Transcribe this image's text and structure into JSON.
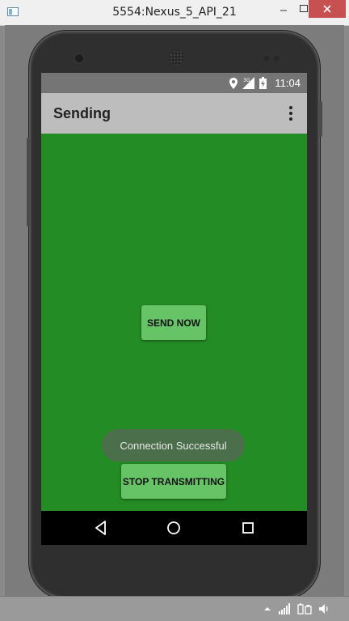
{
  "window": {
    "title": "5554:Nexus_5_API_21"
  },
  "device": {
    "status_bar": {
      "time": "11:04",
      "icons": [
        "location-icon",
        "signal-3g-icon",
        "battery-charging-icon"
      ]
    },
    "app_bar": {
      "title": "Sending",
      "overflow_icon": "more-vert-icon"
    },
    "content": {
      "send_button_label": "SEND NOW",
      "stop_button_label": "STOP TRANSMITTING",
      "toast_message": "Connection Successful",
      "background_color": "#248c24",
      "button_color": "#66c466"
    },
    "nav_bar": {
      "buttons": [
        "back-icon",
        "home-icon",
        "recents-icon"
      ]
    }
  },
  "taskbar": {
    "tray_icons": [
      "show-hidden-icon",
      "network-icon",
      "power-icon",
      "volume-icon"
    ]
  }
}
